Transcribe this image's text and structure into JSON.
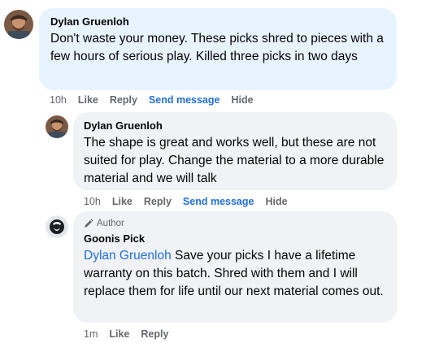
{
  "comments": [
    {
      "author": "Dylan Gruenloh",
      "text": "Don't waste your money. These picks shred to pieces with a few hours of serious play. Killed three picks in two days",
      "time": "10h",
      "actions": [
        "Like",
        "Reply",
        "Send message",
        "Hide"
      ]
    },
    {
      "author": "Dylan Gruenloh",
      "text": "The shape is great and works well, but these are not suited for play. Change the material to a more durable material and we will talk",
      "time": "10h",
      "actions": [
        "Like",
        "Reply",
        "Send message",
        "Hide"
      ]
    },
    {
      "badge": "Author",
      "author": "Goonis Pick",
      "mention": "Dylan Gruenloh",
      "text": " Save your picks I have a lifetime warranty on this batch. Shred with them and I will replace them for life until our next material comes out.",
      "time": "1m",
      "actions": [
        "Like",
        "Reply"
      ]
    }
  ],
  "colors": {
    "highlight_bubble": "#e7f3ff",
    "bubble": "#f0f2f5",
    "link_blue": "#216fdb",
    "meta_gray": "#65676b"
  }
}
